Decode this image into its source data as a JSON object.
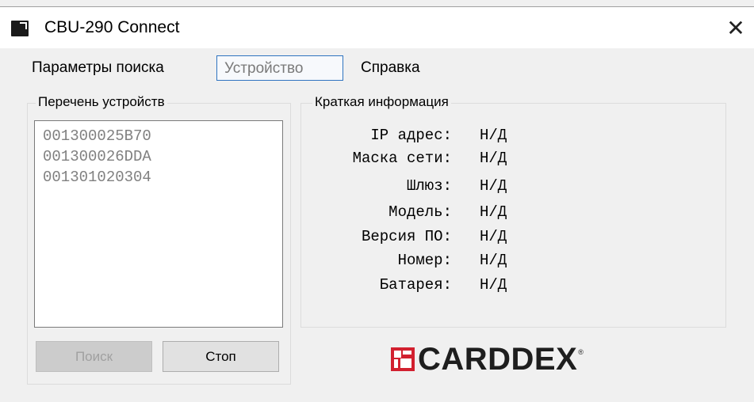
{
  "window": {
    "title": "CBU-290 Connect"
  },
  "menu": {
    "items": [
      {
        "label": "Параметры поиска"
      },
      {
        "label": "Устройство"
      },
      {
        "label": "Справка"
      }
    ]
  },
  "devices": {
    "title": "Перечень устройств",
    "items": [
      "001300025B70",
      "001300026DDA",
      "001301020304"
    ],
    "search_label": "Поиск",
    "stop_label": "Стоп"
  },
  "info": {
    "title": "Краткая информация",
    "rows": [
      {
        "label": "IP адрес:",
        "value": "Н/Д"
      },
      {
        "label": "Маска сети:",
        "value": "Н/Д"
      },
      {
        "label": "Шлюз:",
        "value": "Н/Д"
      },
      {
        "label": "Модель:",
        "value": "Н/Д"
      },
      {
        "label": "Версия ПО:",
        "value": "Н/Д"
      },
      {
        "label": "Номер:",
        "value": "Н/Д"
      },
      {
        "label": "Батарея:",
        "value": "Н/Д"
      }
    ]
  },
  "brand": {
    "logo_text": "CARDDEX",
    "reg_mark": "®",
    "logo_color": "#d2202f"
  }
}
